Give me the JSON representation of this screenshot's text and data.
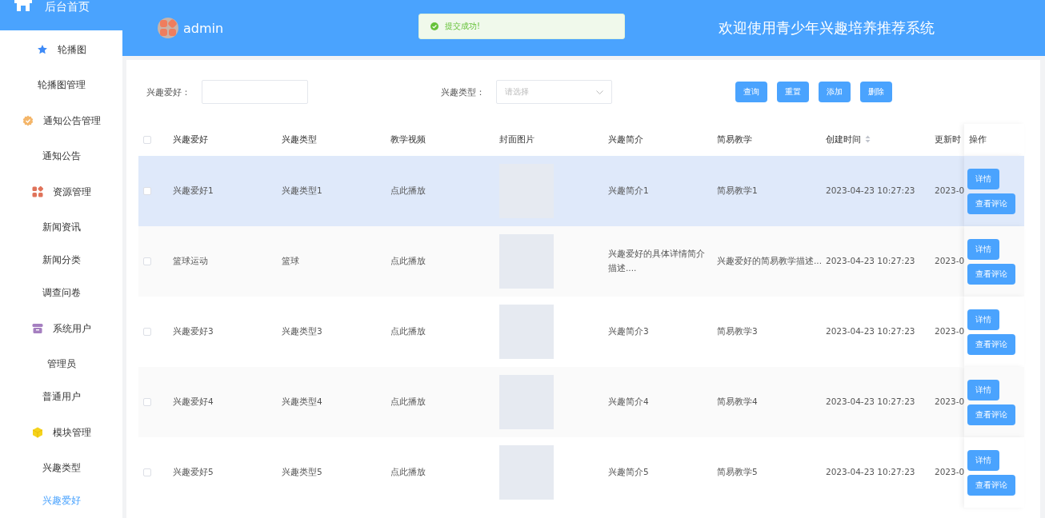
{
  "sidebar": {
    "home": {
      "label": "后台首页"
    },
    "groups": [
      {
        "label": "轮播图",
        "children": [
          {
            "label": "轮播图管理",
            "selected": false
          }
        ]
      },
      {
        "label": "通知公告管理",
        "children": [
          {
            "label": "通知公告",
            "selected": false
          }
        ]
      },
      {
        "label": "资源管理",
        "children": [
          {
            "label": "新闻资讯",
            "selected": false
          },
          {
            "label": "新闻分类",
            "selected": false
          },
          {
            "label": "调查问卷",
            "selected": false
          }
        ]
      },
      {
        "label": "系统用户",
        "children": [
          {
            "label": "管理员",
            "selected": false
          },
          {
            "label": "普通用户",
            "selected": false
          }
        ]
      },
      {
        "label": "模块管理",
        "children": [
          {
            "label": "兴趣类型",
            "selected": false
          },
          {
            "label": "兴趣爱好",
            "selected": true
          }
        ]
      }
    ]
  },
  "header": {
    "user": "admin",
    "toast": "提交成功!",
    "title": "欢迎使用青少年兴趣培养推荐系统"
  },
  "search": {
    "fields": [
      {
        "label": "兴趣爱好：",
        "kind": "input"
      },
      {
        "label": "兴趣类型：",
        "kind": "select",
        "placeholder": "请选择"
      }
    ],
    "buttons": [
      "查询",
      "重置",
      "添加",
      "删除"
    ]
  },
  "table": {
    "all_checked": false,
    "columns": [
      "兴趣爱好",
      "兴趣类型",
      "教学视频",
      "封面图片",
      "兴趣简介",
      "简易教学",
      "创建时间",
      "更新时",
      "操作"
    ],
    "rows": [
      {
        "checked": false,
        "highlighted": true,
        "cells": [
          "兴趣爱好1",
          "兴趣类型1",
          "点此播放",
          "",
          "兴趣简介1",
          "简易教学1",
          "2023-04-23 10:27:23",
          "2023-0"
        ],
        "actions": [
          "详情",
          "查看评论"
        ]
      },
      {
        "checked": false,
        "highlighted": false,
        "cells": [
          "篮球运动",
          "篮球",
          "点此播放",
          "",
          "兴趣爱好的具体详情简介描述....",
          "兴趣爱好的简易教学描述...",
          "2023-04-23 10:27:23",
          "2023-0"
        ],
        "actions": [
          "详情",
          "查看评论"
        ]
      },
      {
        "checked": false,
        "highlighted": false,
        "cells": [
          "兴趣爱好3",
          "兴趣类型3",
          "点此播放",
          "",
          "兴趣简介3",
          "简易教学3",
          "2023-04-23 10:27:23",
          "2023-0"
        ],
        "actions": [
          "详情",
          "查看评论"
        ]
      },
      {
        "checked": false,
        "highlighted": false,
        "cells": [
          "兴趣爱好4",
          "兴趣类型4",
          "点此播放",
          "",
          "兴趣简介4",
          "简易教学4",
          "2023-04-23 10:27:23",
          "2023-0"
        ],
        "actions": [
          "详情",
          "查看评论"
        ]
      },
      {
        "checked": false,
        "highlighted": false,
        "cells": [
          "兴趣爱好5",
          "兴趣类型5",
          "点此播放",
          "",
          "兴趣简介5",
          "简易教学5",
          "2023-04-23 10:27:23",
          "2023-0"
        ],
        "actions": [
          "详情",
          "查看评论"
        ]
      }
    ]
  }
}
